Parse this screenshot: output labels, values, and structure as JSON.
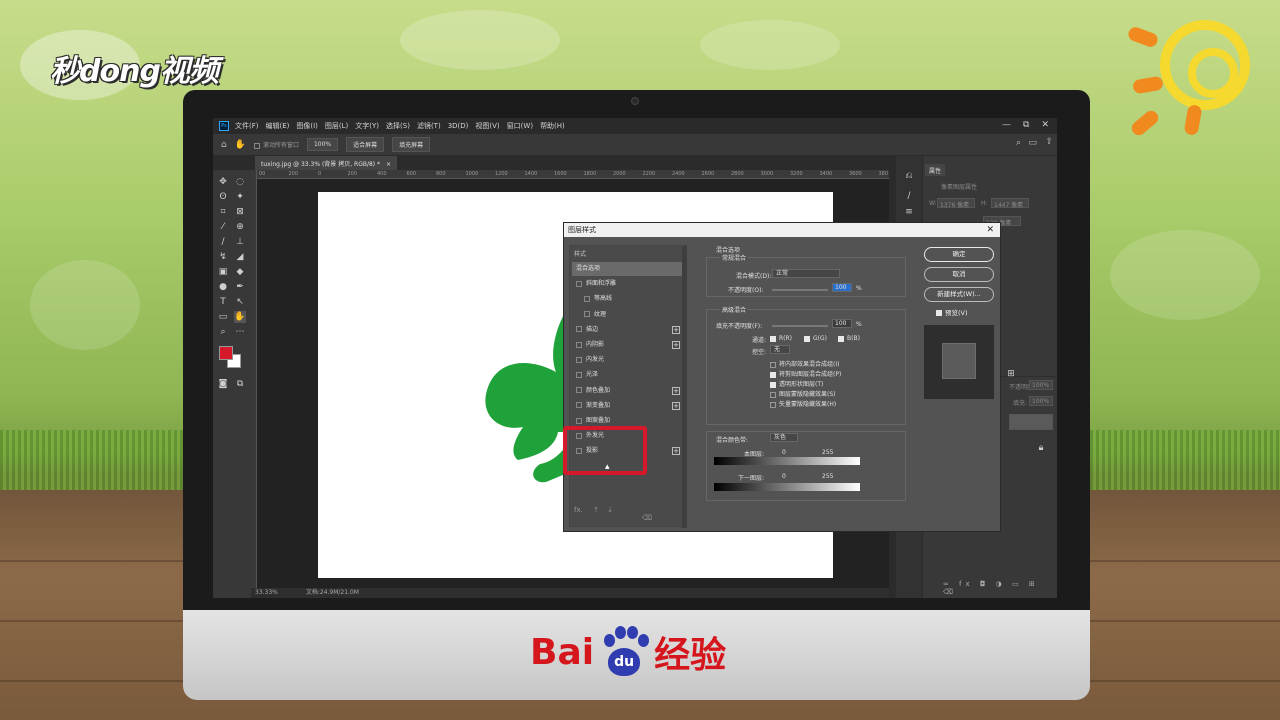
{
  "overlay": {
    "logo_text": "秒dong视频",
    "brand_left": "Bai",
    "brand_du": "du",
    "brand_right": "经验"
  },
  "app": {
    "menu": [
      "文件(F)",
      "编辑(E)",
      "图像(I)",
      "图层(L)",
      "文字(Y)",
      "选择(S)",
      "滤镜(T)",
      "3D(D)",
      "视图(V)",
      "窗口(W)",
      "帮助(H)"
    ],
    "ps_badge": "Ps",
    "win_min": "—",
    "win_max": "⧉",
    "win_close": "✕",
    "options": {
      "scroll_all": "滚动所有窗口",
      "zoom": "100%",
      "fit_screen": "适合屏幕",
      "fill_screen": "填充屏幕"
    },
    "doc_tab": "tuxing.jpg @ 33.3% (背景 拷贝, RGB/8) *",
    "doc_tab_close": "×",
    "ruler_labels": [
      "00",
      "200",
      "0",
      "200",
      "400",
      "600",
      "800",
      "1000",
      "1200",
      "1400",
      "1600",
      "1800",
      "2000",
      "2200",
      "2400",
      "2600",
      "2800",
      "3000",
      "3200",
      "3400",
      "3600",
      "380"
    ],
    "status": {
      "zoom": "33.33%",
      "doc": "文档:24.9M/21.0M"
    },
    "right_panel": {
      "tab": "属性",
      "pixel_props": "像素图层属性",
      "w_label": "W:",
      "w_value": "1376 像素",
      "h_label": "H:",
      "h_value": "1447 像素",
      "x_value": "56 像素",
      "y_value": "128 像素",
      "opacity_label": "不透明度:",
      "opacity_value": "100%",
      "fill_label": "填充:",
      "fill_value": "100%"
    }
  },
  "dialog": {
    "title": "图层样式",
    "close": "✕",
    "styles_header": "样式",
    "styles": [
      {
        "label": "混合选项",
        "checkbox": false,
        "plus": false,
        "indent": false,
        "active": true
      },
      {
        "label": "斜面和浮雕",
        "checkbox": true,
        "plus": false,
        "indent": false,
        "active": false
      },
      {
        "label": "等高线",
        "checkbox": true,
        "plus": false,
        "indent": true,
        "active": false
      },
      {
        "label": "纹理",
        "checkbox": true,
        "plus": false,
        "indent": true,
        "active": false
      },
      {
        "label": "描边",
        "checkbox": true,
        "plus": true,
        "indent": false,
        "active": false
      },
      {
        "label": "内阴影",
        "checkbox": true,
        "plus": true,
        "indent": false,
        "active": false
      },
      {
        "label": "内发光",
        "checkbox": true,
        "plus": false,
        "indent": false,
        "active": false
      },
      {
        "label": "光泽",
        "checkbox": true,
        "plus": false,
        "indent": false,
        "active": false
      },
      {
        "label": "颜色叠加",
        "checkbox": true,
        "plus": true,
        "indent": false,
        "active": false
      },
      {
        "label": "渐变叠加",
        "checkbox": true,
        "plus": true,
        "indent": false,
        "active": false
      },
      {
        "label": "图案叠加",
        "checkbox": true,
        "plus": false,
        "indent": false,
        "active": false
      },
      {
        "label": "外发光",
        "checkbox": true,
        "plus": false,
        "indent": false,
        "active": false
      },
      {
        "label": "投影",
        "checkbox": true,
        "plus": true,
        "indent": false,
        "active": false
      }
    ],
    "footer_fx": "fx.",
    "blend": {
      "section_title": "混合选项",
      "general": "常规混合",
      "blend_mode_label": "混合模式(D):",
      "blend_mode_value": "正常",
      "opacity_label": "不透明度(O):",
      "opacity_value": "100",
      "percent": "%",
      "advanced": "高级混合",
      "fill_opacity_label": "填充不透明度(F):",
      "fill_opacity_value": "100",
      "channels_label": "通道:",
      "channel_r": "R(R)",
      "channel_g": "G(G)",
      "channel_b": "B(B)",
      "knockout_label": "挖空:",
      "knockout_value": "无",
      "opt1": "将内部效果混合成组(I)",
      "opt2": "将剪贴图层混合成组(P)",
      "opt3": "透明形状图层(T)",
      "opt4": "图层蒙版隐藏效果(S)",
      "opt5": "矢量蒙版隐藏效果(H)",
      "blend_if_label": "混合颜色带:",
      "blend_if_value": "灰色",
      "this_layer": "本图层:",
      "this_min": "0",
      "this_max": "255",
      "under_layer": "下一图层:",
      "under_min": "0",
      "under_max": "255"
    },
    "ok": "确定",
    "cancel": "取消",
    "new_style": "新建样式(W)...",
    "preview": "预览(V)"
  },
  "colors": {
    "foreground": "#d5192b",
    "background": "#ffffff",
    "shape": "#1fa23a",
    "highlight": "#d5192b"
  }
}
